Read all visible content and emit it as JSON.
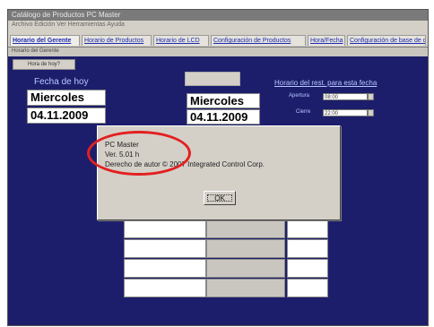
{
  "window": {
    "title": "Catálogo de Productos PC Master",
    "menu": "Archivo  Edición  Ver  Herramientas  Ayuda",
    "subbar": "Horario del Gerente"
  },
  "tabs": [
    {
      "label": "Horario del Gerente",
      "active": true
    },
    {
      "label": "Horario de Productos",
      "active": false
    },
    {
      "label": "Horario de LCD",
      "active": false
    },
    {
      "label": "Configuración de Productos",
      "active": false
    },
    {
      "label": "Hora/Fecha",
      "active": false
    },
    {
      "label": "Configuración de base de datos",
      "active": false
    }
  ],
  "main": {
    "small_button": "Hora de hoy?",
    "fecha_label": "Fecha de hoy",
    "fecha_day": "Miercoles",
    "fecha_date": "04.11.2009",
    "center_day": "Miercoles",
    "center_date": "04.11.2009",
    "horario_label": "Horario del rest. para esta fecha",
    "apertura_label": "Apertura",
    "apertura_value": "08:00",
    "cierre_label": "Cierre",
    "cierre_value": "22:00"
  },
  "dialog": {
    "line1": "PC Master",
    "line2": "Ver. 5.01 h",
    "line3": "Derecho de autor © 2007 Integrated Control Corp.",
    "ok_label": "OK"
  },
  "colors": {
    "main_bg": "#1d1e6b",
    "annotation": "#e32020"
  }
}
